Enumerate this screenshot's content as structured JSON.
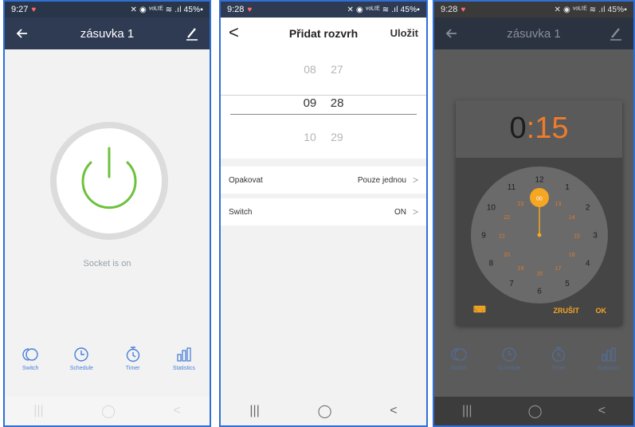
{
  "panel1": {
    "status": {
      "time": "9:27",
      "icons": "✕ ◉ ᵛᵒᴸᵗᴱ ≋ .ıl 45%▪"
    },
    "title": "zásuvka 1",
    "socket_status": "Socket is on",
    "tabs": [
      "Switch",
      "Schedule",
      "Timer",
      "Statistics"
    ],
    "nav": [
      "|||",
      "◯",
      "<"
    ]
  },
  "panel2": {
    "status": {
      "time": "9:28",
      "icons": "✕ ◉ ᵛᵒᴸᵗᴱ ≋ .ıl 45%▪"
    },
    "back": "<",
    "title": "Přidat rozvrh",
    "save": "Uložit",
    "picker": {
      "prev": {
        "hour": "08",
        "minute": "27"
      },
      "selected": {
        "hour": "09",
        "minute": "28"
      },
      "next": {
        "hour": "10",
        "minute": "29"
      }
    },
    "rows": [
      {
        "label": "Opakovat",
        "value": "Pouze jednou"
      },
      {
        "label": "Switch",
        "value": "ON"
      }
    ],
    "nav": [
      "|||",
      "◯",
      "<"
    ]
  },
  "panel3": {
    "status": {
      "time": "9:28",
      "icons": "✕ ◉ ᵛᵒᴸᵗᴱ ≋ .ıl 45%▪"
    },
    "title": "zásuvka 1",
    "time_display": {
      "hour": "0",
      "sep": ":",
      "minute": "15"
    },
    "clock": {
      "outer": [
        "12",
        "1",
        "2",
        "3",
        "4",
        "5",
        "6",
        "7",
        "8",
        "9",
        "10",
        "11"
      ],
      "inner": [
        "00",
        "13",
        "14",
        "15",
        "16",
        "17",
        "18",
        "19",
        "20",
        "21",
        "22",
        "23"
      ],
      "selected": "00"
    },
    "cancel": "ZRUŠIT",
    "ok": "OK",
    "tabs": [
      "Switch",
      "Schedule",
      "Timer",
      "Statistics"
    ],
    "nav": [
      "|||",
      "◯",
      "<"
    ]
  },
  "colors": {
    "header_dark": "#2e3b52",
    "accent_blue": "#4a7fd8",
    "power_green": "#6dc23d",
    "orange": "#f07c2a",
    "amber": "#f5a623"
  }
}
